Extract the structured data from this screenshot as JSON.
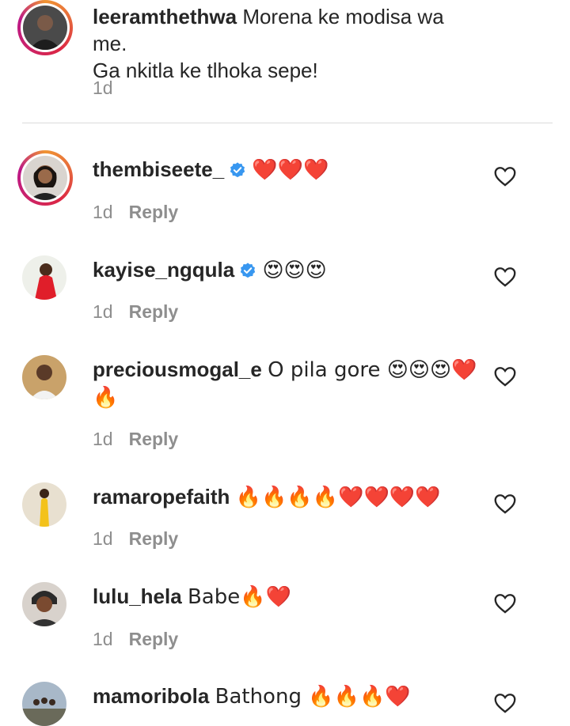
{
  "caption": {
    "username": "leeramthethwa",
    "text": "Morena ke modisa wa me.",
    "text_line2": "Ga nkitla ke tlhoka sepe!",
    "time": "1d"
  },
  "comments": [
    {
      "username": "thembiseete_",
      "verified": true,
      "text": "❤️❤️❤️",
      "text_line2": "",
      "time": "1d",
      "reply": "Reply"
    },
    {
      "username": "kayise_ngqula",
      "verified": true,
      "text": "😍😍😍",
      "text_line2": "",
      "time": "1d",
      "reply": "Reply"
    },
    {
      "username": "preciousmogal_e",
      "verified": false,
      "text": "O pila gore 😍😍😍❤️",
      "text_line2": "🔥",
      "time": "1d",
      "reply": "Reply"
    },
    {
      "username": "ramaropefaith",
      "verified": false,
      "text": "🔥🔥🔥🔥❤️❤️❤️❤️",
      "text_line2": "",
      "time": "1d",
      "reply": "Reply"
    },
    {
      "username": "lulu_hela",
      "verified": false,
      "text": "Babe🔥❤️",
      "text_line2": "",
      "time": "1d",
      "reply": "Reply"
    },
    {
      "username": "mamoribola",
      "verified": false,
      "text": "Bathong 🔥🔥🔥❤️",
      "text_line2": "",
      "time": "",
      "reply": ""
    }
  ],
  "icons": {
    "like": "heart-outline-icon",
    "verified": "verified-badge-icon"
  },
  "colors": {
    "text": "#262626",
    "secondary": "#8e8e8e",
    "verified": "#3897f0",
    "divider": "#dbdbdb"
  }
}
